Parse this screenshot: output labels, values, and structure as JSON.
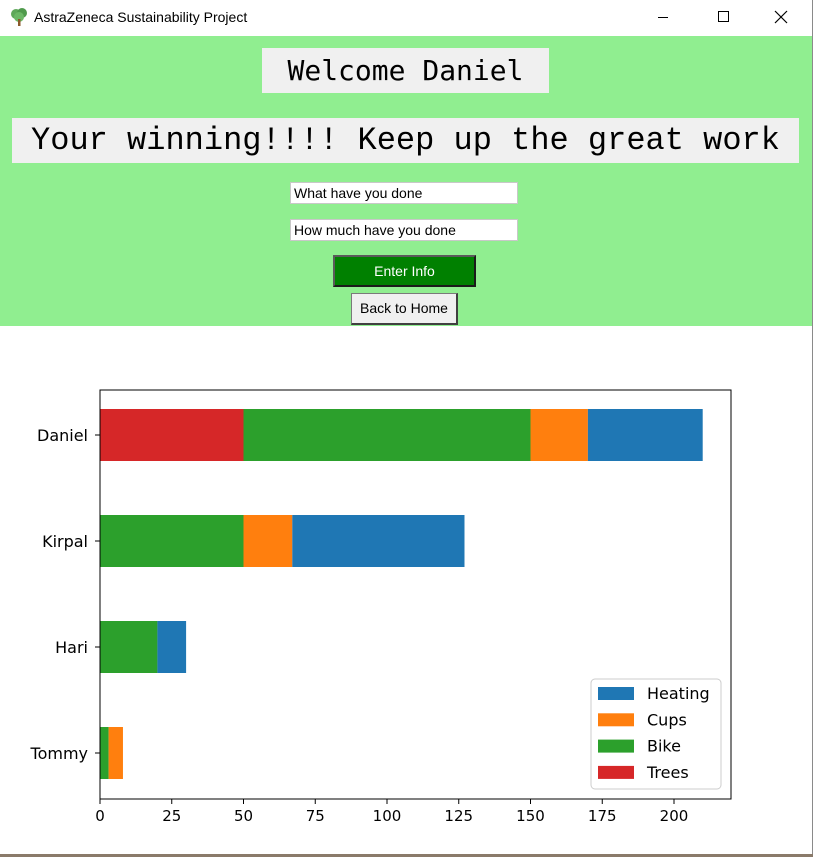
{
  "window": {
    "title": "AstraZeneca Sustainability Project",
    "icon": "tree-icon",
    "controls": [
      "minimize-icon",
      "maximize-icon",
      "close-icon"
    ]
  },
  "header": {
    "welcome": "Welcome Daniel",
    "status": "Your winning!!!! Keep up the great work",
    "background_color": "#90ee90"
  },
  "form": {
    "activity_value": "What have you done",
    "amount_value": "How much have you done",
    "enter_label": "Enter Info",
    "enter_color": "#008000",
    "home_label": "Back to Home"
  },
  "chart_data": {
    "type": "bar",
    "orientation": "horizontal",
    "stacked": true,
    "title": "",
    "xlabel": "",
    "ylabel": "",
    "categories": [
      "Tommy",
      "Hari",
      "Kirpal",
      "Daniel"
    ],
    "series": [
      {
        "name": "Trees",
        "color": "#d62728",
        "values": [
          0,
          0,
          0,
          50
        ]
      },
      {
        "name": "Bike",
        "color": "#2ca02c",
        "values": [
          3,
          20,
          50,
          100
        ]
      },
      {
        "name": "Cups",
        "color": "#ff7f0e",
        "values": [
          5,
          0,
          17,
          20
        ]
      },
      {
        "name": "Heating",
        "color": "#1f77b4",
        "values": [
          0,
          10,
          60,
          40
        ]
      }
    ],
    "xlim": [
      0,
      220
    ],
    "xticks": [
      "0",
      "25",
      "50",
      "75",
      "100",
      "125",
      "150",
      "175",
      "200"
    ],
    "legend": {
      "placement": "lower right",
      "entries": [
        "Heating",
        "Cups",
        "Bike",
        "Trees"
      ]
    },
    "grid": false
  }
}
